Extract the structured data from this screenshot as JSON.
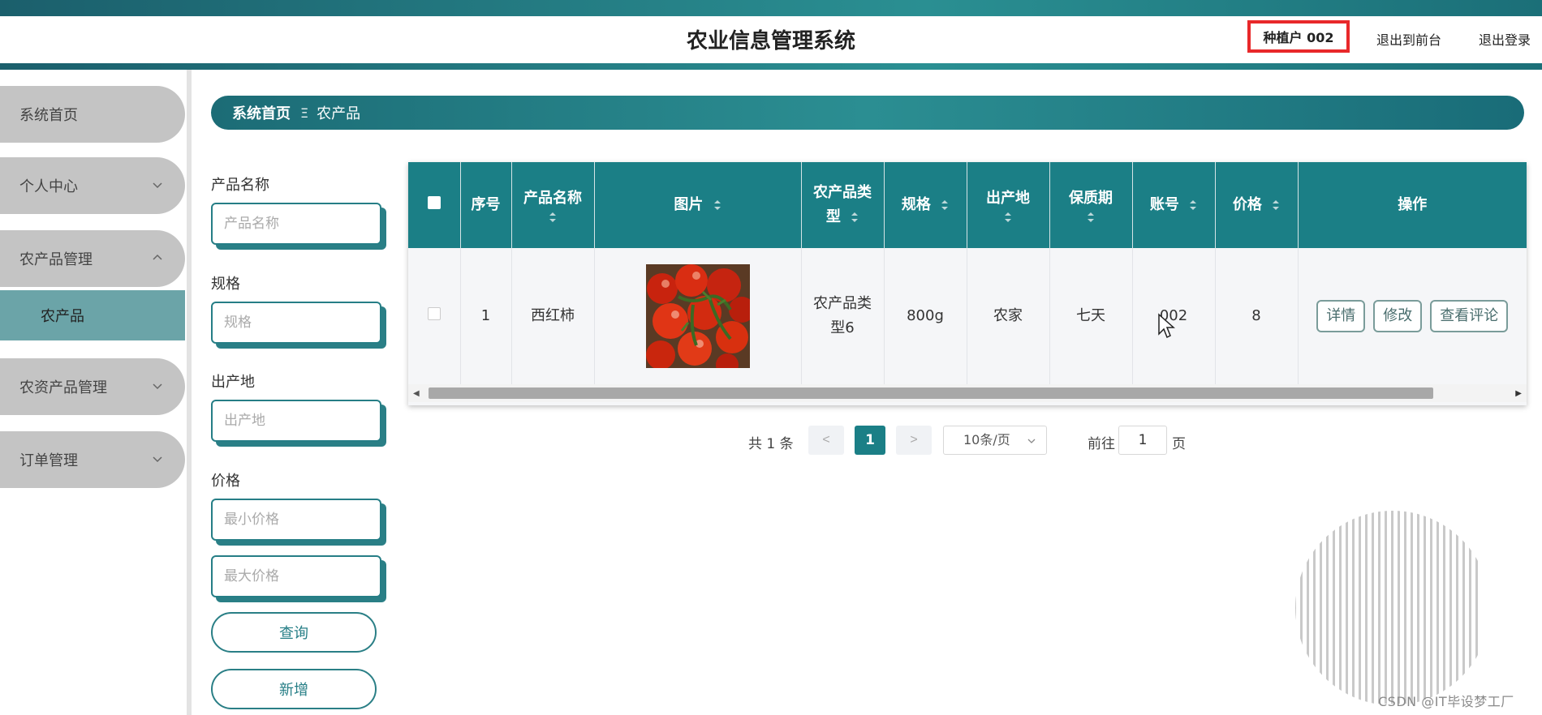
{
  "header": {
    "title": "农业信息管理系统",
    "user": "种植户 002",
    "to_front_label": "退出到前台",
    "logout_label": "退出登录"
  },
  "sidebar": {
    "items": [
      {
        "label": "系统首页",
        "has_chevron": false
      },
      {
        "label": "个人中心",
        "has_chevron": true,
        "chevron": "down"
      },
      {
        "label": "农产品管理",
        "has_chevron": true,
        "chevron": "up",
        "expanded": true
      },
      {
        "label": "农资产品管理",
        "has_chevron": true,
        "chevron": "down"
      },
      {
        "label": "订单管理",
        "has_chevron": true,
        "chevron": "down"
      }
    ],
    "sub_items": [
      {
        "label": "农产品",
        "active": true
      }
    ]
  },
  "breadcrumb": {
    "home": "系统首页",
    "separator": "Ξ",
    "current": "农产品"
  },
  "filters": {
    "name_label": "产品名称",
    "name_placeholder": "产品名称",
    "spec_label": "规格",
    "spec_placeholder": "规格",
    "origin_label": "出产地",
    "origin_placeholder": "出产地",
    "price_label": "价格",
    "min_price_placeholder": "最小价格",
    "max_price_placeholder": "最大价格",
    "query_label": "查询",
    "add_label": "新增"
  },
  "table": {
    "columns": {
      "index": "序号",
      "name": "产品名称",
      "image": "图片",
      "type": "农产品类型",
      "spec": "规格",
      "origin": "出产地",
      "shelf_life": "保质期",
      "account": "账号",
      "price": "价格",
      "actions": "操作"
    },
    "rows": [
      {
        "index": "1",
        "name": "西红柿",
        "image": "tomato-photo",
        "type": "农产品类型6",
        "spec": "800g",
        "origin": "农家",
        "shelf_life": "七天",
        "account": "002",
        "price": "8"
      }
    ],
    "action_labels": {
      "detail": "详情",
      "edit": "修改",
      "comments": "查看评论"
    }
  },
  "pagination": {
    "total": "共 1 条",
    "prev": "<",
    "current": "1",
    "next": ">",
    "page_size": "10条/页",
    "goto_label": "前往",
    "goto_value": "1",
    "page_unit": "页"
  },
  "watermark": "CSDN @IT毕设梦工厂",
  "colors": {
    "primary": "#1b7f86",
    "highlight_border": "#e8282a",
    "menu_bg": "#c4c4c4",
    "submenu_active": "#6ba4a8"
  }
}
